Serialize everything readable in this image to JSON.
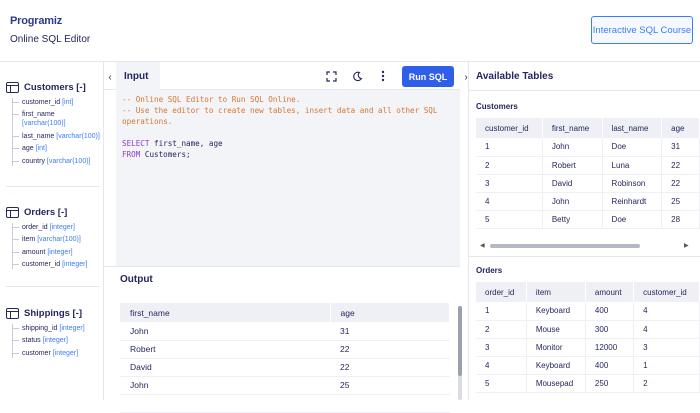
{
  "header": {
    "logo": "Programiz",
    "title": "Online SQL Editor",
    "course_button": "Interactive SQL Course"
  },
  "sidebar": {
    "tables": [
      {
        "name": "Customers [-]",
        "columns": [
          {
            "name": "customer_id",
            "type": "[int]"
          },
          {
            "name": "first_name",
            "type": "[varchar(100)]"
          },
          {
            "name": "last_name",
            "type": "[varchar(100)]"
          },
          {
            "name": "age",
            "type": "[int]"
          },
          {
            "name": "country",
            "type": "[varchar(100)]"
          }
        ]
      },
      {
        "name": "Orders [-]",
        "columns": [
          {
            "name": "order_id",
            "type": "[integer]"
          },
          {
            "name": "item",
            "type": "[varchar(100)]"
          },
          {
            "name": "amount",
            "type": "[integer]"
          },
          {
            "name": "customer_id",
            "type": "[integer]"
          }
        ]
      },
      {
        "name": "Shippings [-]",
        "columns": [
          {
            "name": "shipping_id",
            "type": "[integer]"
          },
          {
            "name": "status",
            "type": "[integer]"
          },
          {
            "name": "customer",
            "type": "[integer]"
          }
        ]
      }
    ]
  },
  "editor": {
    "tab_label": "Input",
    "run_label": "Run SQL",
    "icons": [
      "fullscreen-icon",
      "moon-icon",
      "kebab-menu-icon"
    ],
    "code": {
      "comment1": "-- Online SQL Editor to Run SQL Online.",
      "comment2": "-- Use the editor to create new tables, insert data and all other SQL",
      "comment2b": "operations.",
      "select_kw": "SELECT",
      "select_rest": " first_name, age",
      "from_kw": "FROM",
      "from_rest": " Customers;"
    }
  },
  "output": {
    "label": "Output",
    "headers": [
      "first_name",
      "age"
    ],
    "rows": [
      [
        "John",
        "31"
      ],
      [
        "Robert",
        "22"
      ],
      [
        "David",
        "22"
      ],
      [
        "John",
        "25"
      ],
      [
        "",
        ""
      ]
    ]
  },
  "available": {
    "title": "Available Tables",
    "customers": {
      "label": "Customers",
      "headers": [
        "customer_id",
        "first_name",
        "last_name",
        "age"
      ],
      "rows": [
        [
          "1",
          "John",
          "Doe",
          "31"
        ],
        [
          "2",
          "Robert",
          "Luna",
          "22"
        ],
        [
          "3",
          "David",
          "Robinson",
          "22"
        ],
        [
          "4",
          "John",
          "Reinhardt",
          "25"
        ],
        [
          "5",
          "Betty",
          "Doe",
          "28"
        ]
      ]
    },
    "orders": {
      "label": "Orders",
      "headers": [
        "order_id",
        "item",
        "amount",
        "customer_id"
      ],
      "rows": [
        [
          "1",
          "Keyboard",
          "400",
          "4"
        ],
        [
          "2",
          "Mouse",
          "300",
          "4"
        ],
        [
          "3",
          "Monitor",
          "12000",
          "3"
        ],
        [
          "4",
          "Keyboard",
          "400",
          "1"
        ],
        [
          "5",
          "Mousepad",
          "250",
          "2"
        ]
      ]
    }
  }
}
